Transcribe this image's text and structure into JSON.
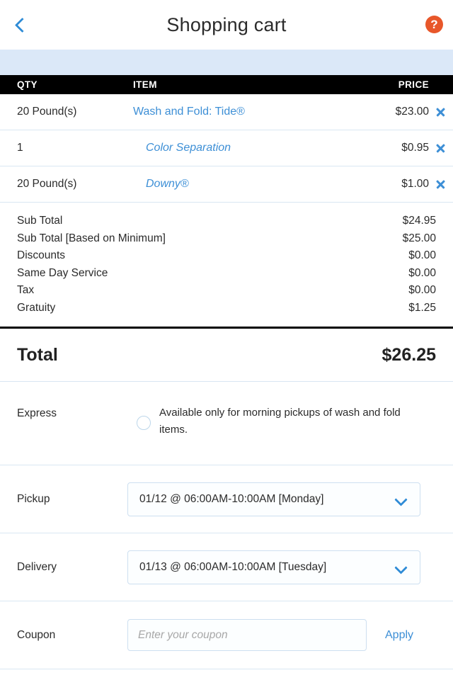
{
  "header": {
    "title": "Shopping cart",
    "back_icon": "chevron-left-icon",
    "help_icon": "question-mark-icon",
    "help_label": "?"
  },
  "table": {
    "columns": [
      "QTY",
      "ITEM",
      "PRICE"
    ],
    "rows": [
      {
        "qty": "20 Pound(s)",
        "item": "Wash and Fold: Tide®",
        "price": "$23.00",
        "sub": false
      },
      {
        "qty": "1",
        "item": "Color Separation",
        "price": "$0.95",
        "sub": true
      },
      {
        "qty": "20 Pound(s)",
        "item": "Downy®",
        "price": "$1.00",
        "sub": true
      }
    ],
    "remove_icon": "close-x-icon"
  },
  "summary": {
    "lines": [
      {
        "label": "Sub Total",
        "value": "$24.95"
      },
      {
        "label": "Sub Total [Based on Minimum]",
        "value": "$25.00"
      },
      {
        "label": "Discounts",
        "value": "$0.00"
      },
      {
        "label": "Same Day Service",
        "value": "$0.00"
      },
      {
        "label": "Tax",
        "value": "$0.00"
      },
      {
        "label": "Gratuity",
        "value": "$1.25"
      }
    ]
  },
  "total": {
    "label": "Total",
    "value": "$26.25"
  },
  "express": {
    "label": "Express",
    "description": "Available only for morning pickups of wash and fold items.",
    "selected": false
  },
  "pickup": {
    "label": "Pickup",
    "value": "01/12 @ 06:00AM-10:00AM [Monday]",
    "chevron_icon": "chevron-down-icon"
  },
  "delivery": {
    "label": "Delivery",
    "value": "01/13 @ 06:00AM-10:00AM [Tuesday]",
    "chevron_icon": "chevron-down-icon"
  },
  "coupon": {
    "label": "Coupon",
    "placeholder": "Enter your coupon",
    "value": "",
    "apply_label": "Apply"
  },
  "colors": {
    "accent_blue": "#3d8fd6",
    "help_orange": "#e8572a",
    "banner_blue": "#dbe8f8",
    "divider": "#d9e6f2"
  }
}
